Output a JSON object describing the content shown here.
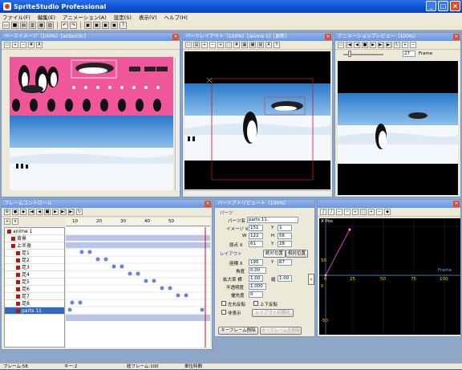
{
  "app": {
    "title": "SpriteStudio Professional"
  },
  "menu": [
    "ファイル(F)",
    "編集(E)",
    "アニメーション(A)",
    "設定(S)",
    "表示(V)",
    "ヘルプ(H)"
  ],
  "panels": {
    "base_image": {
      "title": "ベースイメージ（100%）[antarctic]"
    },
    "parts_layout": {
      "title": "パーツレイアウト（100%）[anime 1]［更新］"
    },
    "preview": {
      "title": "アニメーションプレビュー（100%）",
      "frame_value": "27",
      "frame_label": "Frame"
    },
    "frame_control": {
      "title": "フレームコントロール"
    },
    "parts_attr": {
      "title": "パーツアトリビュート（100%）"
    }
  },
  "timeline": {
    "ticks": [
      "10",
      "20",
      "30",
      "40",
      "50"
    ],
    "parts": [
      "anime 1",
      "背景",
      "上半身",
      "足1",
      "足2",
      "足3",
      "足4",
      "足5",
      "足6",
      "足7",
      "足8",
      "parts 11"
    ]
  },
  "attributes": {
    "section_parts": "パーツ",
    "name_label": "パーツ名",
    "name_value": "parts 11",
    "image_x_label": "イメージ X",
    "image_x": "151",
    "y_label": "Y",
    "image_y": "1",
    "w_label": "W",
    "w_value": "122",
    "h_label": "H",
    "h_value": "56",
    "origin_x_label": "原点 X",
    "origin_x": "61",
    "origin_y_label": "Y",
    "origin_y": "28",
    "section_layout": "レイアウト",
    "tab_abs": "絶対位置",
    "tab_rel": "相対位置",
    "pos_x_label": "座標 X",
    "pos_x": "195",
    "pos_y_label": "Y",
    "pos_y": "67",
    "angle_label": "角度",
    "angle": "0.00",
    "scale_label": "拡大率 横",
    "scale_x": "1.00",
    "scale_v_label": "縦",
    "scale_y": "1.00",
    "alpha_label": "不透明度",
    "alpha": "1.000",
    "priority_label": "優先度",
    "priority": "0",
    "flip_h": "左右反転",
    "flip_v": "上下反転",
    "hide": "非表示",
    "reset_button": "レイアウト初期化",
    "keyframe_delete": "キーフレーム削除",
    "keyframe_delete_all": "キーフレーム全削除"
  },
  "graph": {
    "title": "X Pos",
    "x_ticks": [
      "0",
      "25",
      "50",
      "75",
      "100"
    ],
    "y_ticks": [
      "50",
      "0",
      "-50"
    ],
    "frame_label": "Frame"
  },
  "status": {
    "frame": "フレーム:58",
    "key": "キー:2",
    "total_frames": "総フレーム:100",
    "unit": "単位時間"
  },
  "colors": {
    "titlebar": "#0a4fd0",
    "panel_title": "#6b95dc",
    "pink_bg": "#f0569a",
    "selection": "#316ac5"
  }
}
